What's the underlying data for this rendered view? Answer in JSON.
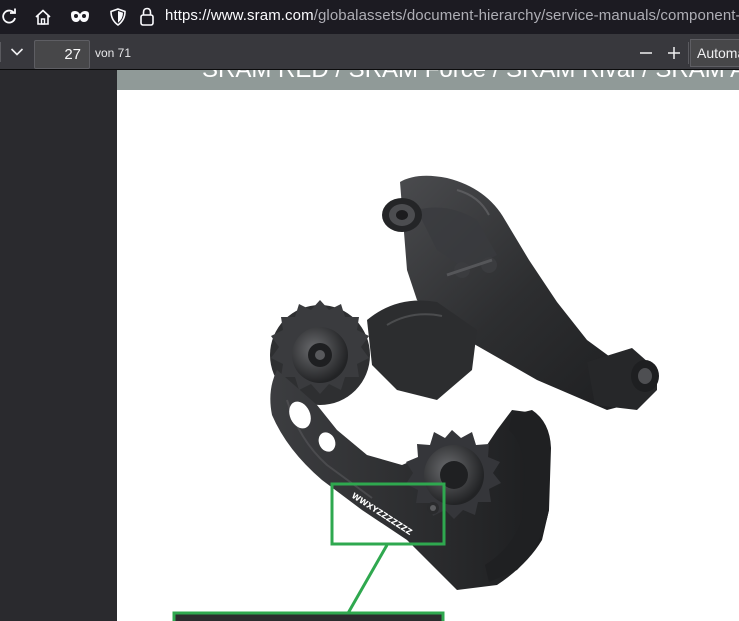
{
  "browser": {
    "url_host": "https://www.sram.com",
    "url_path": "/globalassets/document-hierarchy/service-manuals/component-seria"
  },
  "pdf_toolbar": {
    "page_number": "27",
    "page_count": "von 71",
    "zoom_out_label": "—",
    "zoom_in_label": "+",
    "zoom_value": "Automa"
  },
  "page": {
    "header_title": "SRAM RED / SRAM Force / SRAM Rival / SRAM Ap",
    "serial_label": "WWXYZZZZZZZ"
  },
  "colors": {
    "callout_green": "#2fa84f",
    "header_gray": "#909a98",
    "part_dark": "#2b2c2e"
  },
  "icons": [
    "reload-icon",
    "home-icon",
    "mask-icon",
    "shield-icon",
    "lock-icon",
    "chevron-down-icon",
    "minus-icon",
    "plus-icon"
  ]
}
